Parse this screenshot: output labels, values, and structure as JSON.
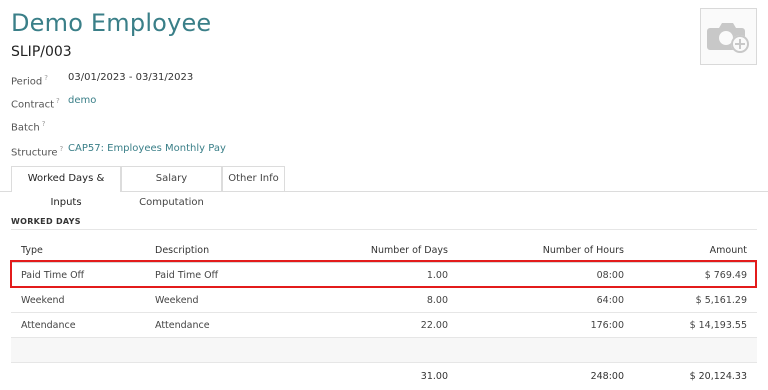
{
  "header": {
    "title": "Demo Employee",
    "reference": "SLIP/003"
  },
  "photo": {
    "icon": "camera-add-icon"
  },
  "fields": {
    "period": {
      "label": "Period",
      "help": "?",
      "value": "03/01/2023 - 03/31/2023"
    },
    "contract": {
      "label": "Contract",
      "help": "?",
      "value": "demo"
    },
    "batch": {
      "label": "Batch",
      "help": "?",
      "value": ""
    },
    "structure": {
      "label": "Structure",
      "help": "?",
      "value": "CAP57: Employees Monthly Pay"
    }
  },
  "tabs": [
    {
      "label": "Worked Days & Inputs",
      "active": true
    },
    {
      "label": "Salary Computation",
      "active": false
    },
    {
      "label": "Other Info",
      "active": false
    }
  ],
  "worked_days": {
    "section_title": "WORKED DAYS",
    "columns": [
      "Type",
      "Description",
      "Number of Days",
      "Number of Hours",
      "Amount"
    ],
    "rows": [
      {
        "type": "Paid Time Off",
        "description": "Paid Time Off",
        "days": "1.00",
        "hours": "08:00",
        "amount": "$ 769.49",
        "highlighted": true
      },
      {
        "type": "Weekend",
        "description": "Weekend",
        "days": "8.00",
        "hours": "64:00",
        "amount": "$ 5,161.29",
        "highlighted": false
      },
      {
        "type": "Attendance",
        "description": "Attendance",
        "days": "22.00",
        "hours": "176:00",
        "amount": "$ 14,193.55",
        "highlighted": false
      }
    ],
    "totals": {
      "days": "31.00",
      "hours": "248:00",
      "amount": "$ 20,124.33"
    }
  },
  "colors": {
    "accent": "#3a7f88",
    "highlight": "#e31b1b"
  }
}
